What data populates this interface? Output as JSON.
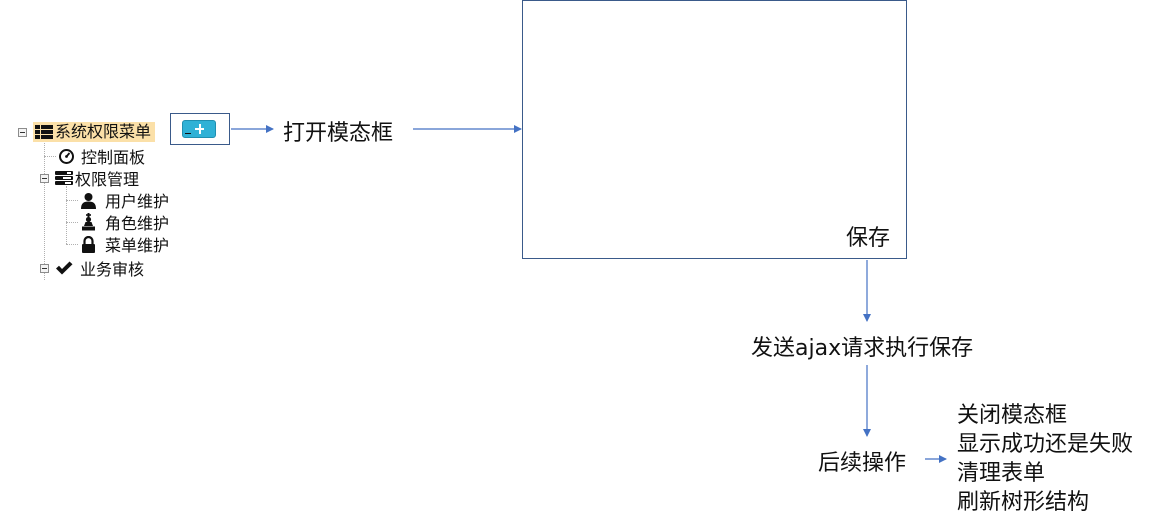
{
  "tree": {
    "root": "系统权限菜单",
    "items": [
      {
        "label": "控制面板",
        "icon": "dashboard-icon"
      },
      {
        "label": "权限管理",
        "icon": "tasks-icon"
      },
      {
        "label": "用户维护",
        "icon": "user-icon"
      },
      {
        "label": "角色维护",
        "icon": "king-icon"
      },
      {
        "label": "菜单维护",
        "icon": "lock-icon"
      },
      {
        "label": "业务审核",
        "icon": "ok-icon"
      }
    ]
  },
  "steps": {
    "open_modal": "打开模态框",
    "save": "保存",
    "send_ajax": "发送ajax请求执行保存",
    "follow_up": "后续操作"
  },
  "results": [
    "关闭模态框",
    "显示成功还是失败",
    "清理表单",
    "刷新树形结构"
  ],
  "colors": {
    "arrow": "#4472c4",
    "box_border": "#3a5a8a",
    "root_highlight": "#fbe0a8",
    "add_button": "#2fb1d6"
  }
}
